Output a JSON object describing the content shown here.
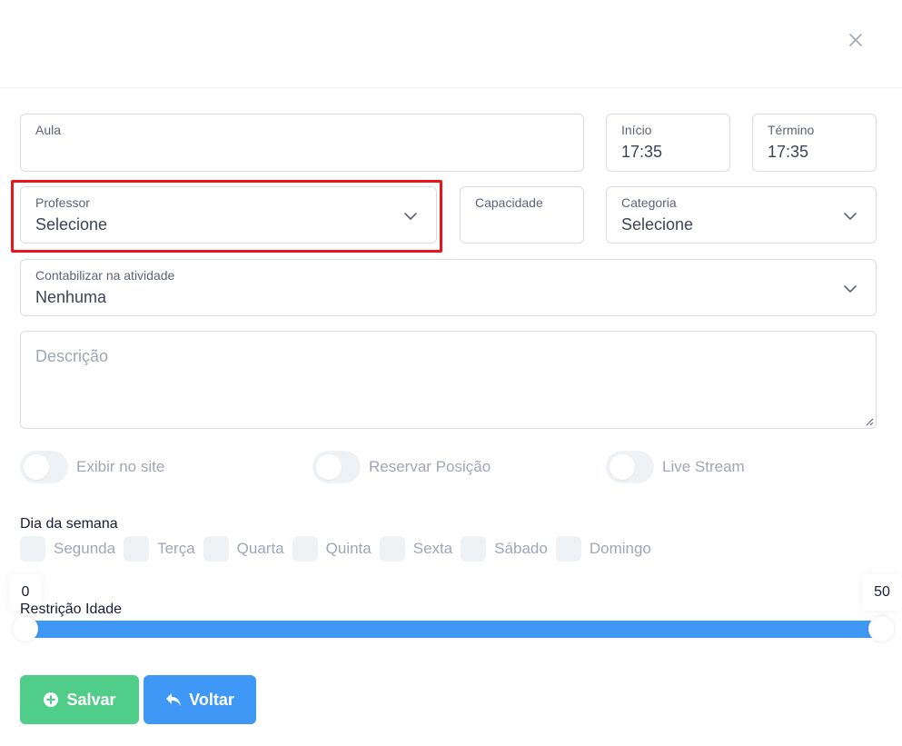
{
  "form": {
    "aula": {
      "label": "Aula",
      "value": ""
    },
    "inicio": {
      "label": "Início",
      "value": "17:35"
    },
    "termino": {
      "label": "Término",
      "value": "17:35"
    },
    "professor": {
      "label": "Professor",
      "value": "Selecione"
    },
    "capacidade": {
      "label": "Capacidade",
      "value": ""
    },
    "categoria": {
      "label": "Categoria",
      "value": "Selecione"
    },
    "contabilizar": {
      "label": "Contabilizar na atividade",
      "value": "Nenhuma"
    },
    "descricao": {
      "placeholder": "Descrição"
    }
  },
  "toggles": [
    {
      "label": "Exibir no site",
      "on": false
    },
    {
      "label": "Reservar Posição",
      "on": false
    },
    {
      "label": "Live Stream",
      "on": false
    }
  ],
  "weekdays": {
    "title": "Dia da semana",
    "days": [
      "Segunda",
      "Terça",
      "Quarta",
      "Quinta",
      "Sexta",
      "Sábado",
      "Domingo"
    ]
  },
  "age_restriction": {
    "label": "Restrição Idade",
    "min": "0",
    "max": "50"
  },
  "buttons": {
    "save": "Salvar",
    "back": "Voltar"
  },
  "colors": {
    "save": "#50cd89",
    "back": "#3f98f5",
    "highlight": "#e8161a"
  },
  "icons": {
    "close": "close-icon",
    "chevron": "chevron-down-icon",
    "save": "plus-circle-icon",
    "back": "reply-arrow-icon"
  }
}
